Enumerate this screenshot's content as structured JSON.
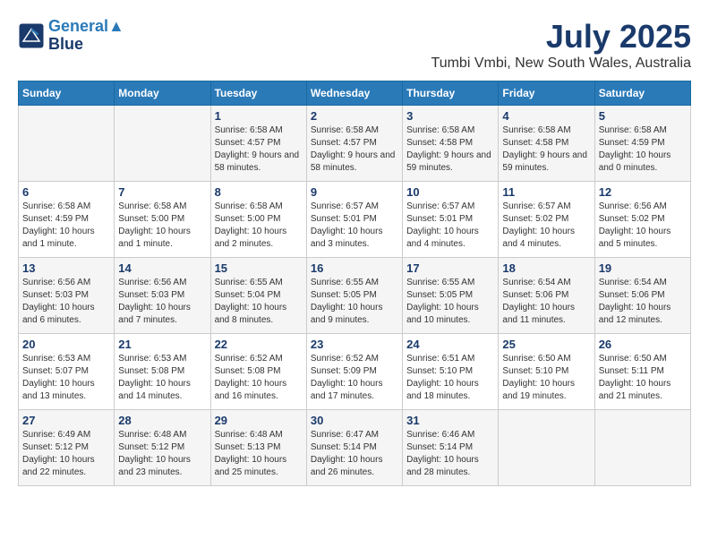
{
  "header": {
    "logo_line1": "General",
    "logo_line2": "Blue",
    "month": "July 2025",
    "location": "Tumbi Vmbi, New South Wales, Australia"
  },
  "days_of_week": [
    "Sunday",
    "Monday",
    "Tuesday",
    "Wednesday",
    "Thursday",
    "Friday",
    "Saturday"
  ],
  "weeks": [
    [
      {
        "day": "",
        "sunrise": "",
        "sunset": "",
        "daylight": ""
      },
      {
        "day": "",
        "sunrise": "",
        "sunset": "",
        "daylight": ""
      },
      {
        "day": "1",
        "sunrise": "Sunrise: 6:58 AM",
        "sunset": "Sunset: 4:57 PM",
        "daylight": "Daylight: 9 hours and 58 minutes."
      },
      {
        "day": "2",
        "sunrise": "Sunrise: 6:58 AM",
        "sunset": "Sunset: 4:57 PM",
        "daylight": "Daylight: 9 hours and 58 minutes."
      },
      {
        "day": "3",
        "sunrise": "Sunrise: 6:58 AM",
        "sunset": "Sunset: 4:58 PM",
        "daylight": "Daylight: 9 hours and 59 minutes."
      },
      {
        "day": "4",
        "sunrise": "Sunrise: 6:58 AM",
        "sunset": "Sunset: 4:58 PM",
        "daylight": "Daylight: 9 hours and 59 minutes."
      },
      {
        "day": "5",
        "sunrise": "Sunrise: 6:58 AM",
        "sunset": "Sunset: 4:59 PM",
        "daylight": "Daylight: 10 hours and 0 minutes."
      }
    ],
    [
      {
        "day": "6",
        "sunrise": "Sunrise: 6:58 AM",
        "sunset": "Sunset: 4:59 PM",
        "daylight": "Daylight: 10 hours and 1 minute."
      },
      {
        "day": "7",
        "sunrise": "Sunrise: 6:58 AM",
        "sunset": "Sunset: 5:00 PM",
        "daylight": "Daylight: 10 hours and 1 minute."
      },
      {
        "day": "8",
        "sunrise": "Sunrise: 6:58 AM",
        "sunset": "Sunset: 5:00 PM",
        "daylight": "Daylight: 10 hours and 2 minutes."
      },
      {
        "day": "9",
        "sunrise": "Sunrise: 6:57 AM",
        "sunset": "Sunset: 5:01 PM",
        "daylight": "Daylight: 10 hours and 3 minutes."
      },
      {
        "day": "10",
        "sunrise": "Sunrise: 6:57 AM",
        "sunset": "Sunset: 5:01 PM",
        "daylight": "Daylight: 10 hours and 4 minutes."
      },
      {
        "day": "11",
        "sunrise": "Sunrise: 6:57 AM",
        "sunset": "Sunset: 5:02 PM",
        "daylight": "Daylight: 10 hours and 4 minutes."
      },
      {
        "day": "12",
        "sunrise": "Sunrise: 6:56 AM",
        "sunset": "Sunset: 5:02 PM",
        "daylight": "Daylight: 10 hours and 5 minutes."
      }
    ],
    [
      {
        "day": "13",
        "sunrise": "Sunrise: 6:56 AM",
        "sunset": "Sunset: 5:03 PM",
        "daylight": "Daylight: 10 hours and 6 minutes."
      },
      {
        "day": "14",
        "sunrise": "Sunrise: 6:56 AM",
        "sunset": "Sunset: 5:03 PM",
        "daylight": "Daylight: 10 hours and 7 minutes."
      },
      {
        "day": "15",
        "sunrise": "Sunrise: 6:55 AM",
        "sunset": "Sunset: 5:04 PM",
        "daylight": "Daylight: 10 hours and 8 minutes."
      },
      {
        "day": "16",
        "sunrise": "Sunrise: 6:55 AM",
        "sunset": "Sunset: 5:05 PM",
        "daylight": "Daylight: 10 hours and 9 minutes."
      },
      {
        "day": "17",
        "sunrise": "Sunrise: 6:55 AM",
        "sunset": "Sunset: 5:05 PM",
        "daylight": "Daylight: 10 hours and 10 minutes."
      },
      {
        "day": "18",
        "sunrise": "Sunrise: 6:54 AM",
        "sunset": "Sunset: 5:06 PM",
        "daylight": "Daylight: 10 hours and 11 minutes."
      },
      {
        "day": "19",
        "sunrise": "Sunrise: 6:54 AM",
        "sunset": "Sunset: 5:06 PM",
        "daylight": "Daylight: 10 hours and 12 minutes."
      }
    ],
    [
      {
        "day": "20",
        "sunrise": "Sunrise: 6:53 AM",
        "sunset": "Sunset: 5:07 PM",
        "daylight": "Daylight: 10 hours and 13 minutes."
      },
      {
        "day": "21",
        "sunrise": "Sunrise: 6:53 AM",
        "sunset": "Sunset: 5:08 PM",
        "daylight": "Daylight: 10 hours and 14 minutes."
      },
      {
        "day": "22",
        "sunrise": "Sunrise: 6:52 AM",
        "sunset": "Sunset: 5:08 PM",
        "daylight": "Daylight: 10 hours and 16 minutes."
      },
      {
        "day": "23",
        "sunrise": "Sunrise: 6:52 AM",
        "sunset": "Sunset: 5:09 PM",
        "daylight": "Daylight: 10 hours and 17 minutes."
      },
      {
        "day": "24",
        "sunrise": "Sunrise: 6:51 AM",
        "sunset": "Sunset: 5:10 PM",
        "daylight": "Daylight: 10 hours and 18 minutes."
      },
      {
        "day": "25",
        "sunrise": "Sunrise: 6:50 AM",
        "sunset": "Sunset: 5:10 PM",
        "daylight": "Daylight: 10 hours and 19 minutes."
      },
      {
        "day": "26",
        "sunrise": "Sunrise: 6:50 AM",
        "sunset": "Sunset: 5:11 PM",
        "daylight": "Daylight: 10 hours and 21 minutes."
      }
    ],
    [
      {
        "day": "27",
        "sunrise": "Sunrise: 6:49 AM",
        "sunset": "Sunset: 5:12 PM",
        "daylight": "Daylight: 10 hours and 22 minutes."
      },
      {
        "day": "28",
        "sunrise": "Sunrise: 6:48 AM",
        "sunset": "Sunset: 5:12 PM",
        "daylight": "Daylight: 10 hours and 23 minutes."
      },
      {
        "day": "29",
        "sunrise": "Sunrise: 6:48 AM",
        "sunset": "Sunset: 5:13 PM",
        "daylight": "Daylight: 10 hours and 25 minutes."
      },
      {
        "day": "30",
        "sunrise": "Sunrise: 6:47 AM",
        "sunset": "Sunset: 5:14 PM",
        "daylight": "Daylight: 10 hours and 26 minutes."
      },
      {
        "day": "31",
        "sunrise": "Sunrise: 6:46 AM",
        "sunset": "Sunset: 5:14 PM",
        "daylight": "Daylight: 10 hours and 28 minutes."
      },
      {
        "day": "",
        "sunrise": "",
        "sunset": "",
        "daylight": ""
      },
      {
        "day": "",
        "sunrise": "",
        "sunset": "",
        "daylight": ""
      }
    ]
  ]
}
